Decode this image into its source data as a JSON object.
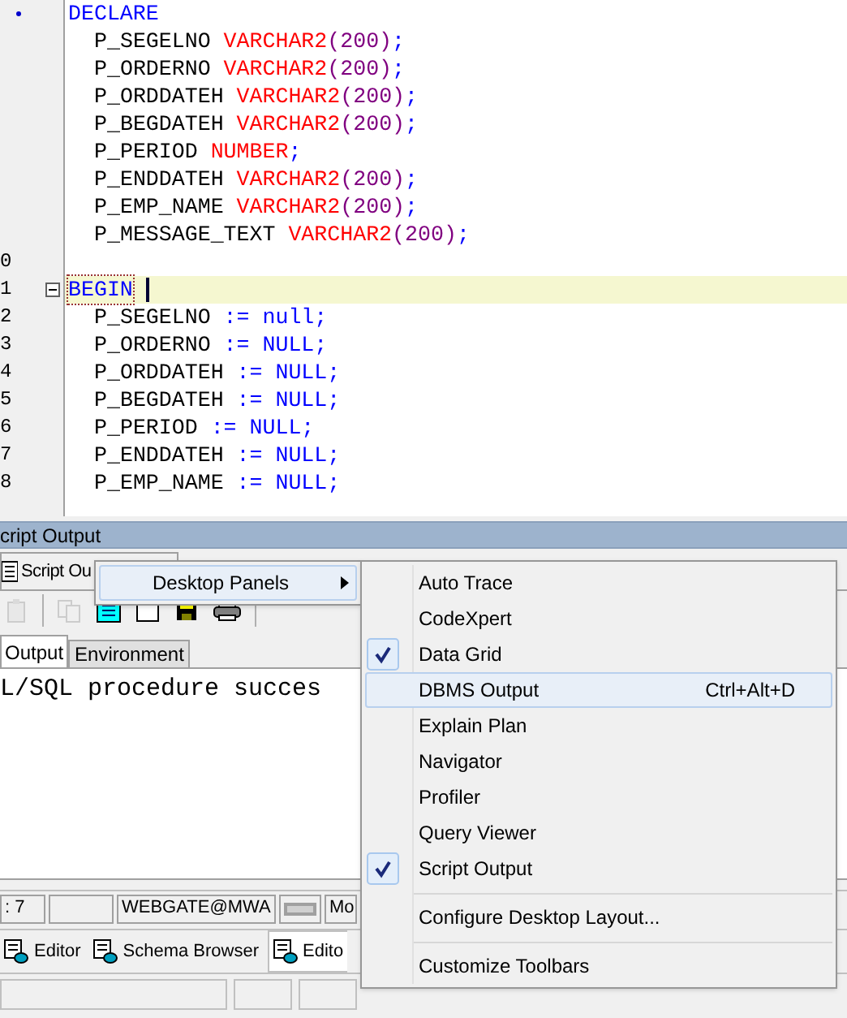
{
  "editor": {
    "lines": [
      {
        "bookmark": true,
        "tokens": [
          {
            "kind": "keyword",
            "text": "DECLARE"
          }
        ],
        "children": [
          {
            "tokens": [
              {
                "kind": "name",
                "text": "P_SEGELNO "
              },
              {
                "kind": "type",
                "text": "VARCHAR2"
              },
              {
                "kind": "size",
                "text": "(200)"
              },
              {
                "kind": "keyword",
                "text": ";"
              }
            ]
          },
          {
            "tokens": [
              {
                "kind": "name",
                "text": "P_ORDERNO "
              },
              {
                "kind": "type",
                "text": "VARCHAR2"
              },
              {
                "kind": "size",
                "text": "(200)"
              },
              {
                "kind": "keyword",
                "text": ";"
              }
            ]
          },
          {
            "tokens": [
              {
                "kind": "name",
                "text": "P_ORDDATEH "
              },
              {
                "kind": "type",
                "text": "VARCHAR2"
              },
              {
                "kind": "size",
                "text": "(200)"
              },
              {
                "kind": "keyword",
                "text": ";"
              }
            ]
          },
          {
            "tokens": [
              {
                "kind": "name",
                "text": "P_BEGDATEH "
              },
              {
                "kind": "type",
                "text": "VARCHAR2"
              },
              {
                "kind": "size",
                "text": "(200)"
              },
              {
                "kind": "keyword",
                "text": ";"
              }
            ]
          },
          {
            "tokens": [
              {
                "kind": "name",
                "text": "P_PERIOD "
              },
              {
                "kind": "type",
                "text": "NUMBER"
              },
              {
                "kind": "keyword",
                "text": ";"
              }
            ]
          },
          {
            "tokens": [
              {
                "kind": "name",
                "text": "P_ENDDATEH "
              },
              {
                "kind": "type",
                "text": "VARCHAR2"
              },
              {
                "kind": "size",
                "text": "(200)"
              },
              {
                "kind": "keyword",
                "text": ";"
              }
            ]
          },
          {
            "tokens": [
              {
                "kind": "name",
                "text": "P_EMP_NAME "
              },
              {
                "kind": "type",
                "text": "VARCHAR2"
              },
              {
                "kind": "size",
                "text": "(200)"
              },
              {
                "kind": "keyword",
                "text": ";"
              }
            ]
          },
          {
            "tokens": [
              {
                "kind": "name",
                "text": "P_MESSAGE_TEXT "
              },
              {
                "kind": "type",
                "text": "VARCHAR2"
              },
              {
                "kind": "size",
                "text": "(200)"
              },
              {
                "kind": "keyword",
                "text": ";"
              }
            ]
          }
        ]
      },
      {
        "number": "0"
      },
      {
        "number": "1",
        "collapsible": true,
        "current": true,
        "tokens": [
          {
            "kind": "keyword",
            "text": "BEGIN"
          }
        ],
        "children": [
          {
            "number": "2",
            "tokens": [
              {
                "kind": "name",
                "text": "P_SEGELNO "
              },
              {
                "kind": "keyword",
                "text": ":= null;"
              }
            ]
          },
          {
            "number": "3",
            "tokens": [
              {
                "kind": "name",
                "text": "P_ORDERNO "
              },
              {
                "kind": "keyword",
                "text": ":= NULL;"
              }
            ]
          },
          {
            "number": "4",
            "tokens": [
              {
                "kind": "name",
                "text": "P_ORDDATEH "
              },
              {
                "kind": "keyword",
                "text": ":= NULL;"
              }
            ]
          },
          {
            "number": "5",
            "tokens": [
              {
                "kind": "name",
                "text": "P_BEGDATEH "
              },
              {
                "kind": "keyword",
                "text": ":= NULL;"
              }
            ]
          },
          {
            "number": "6",
            "tokens": [
              {
                "kind": "name",
                "text": "P_PERIOD "
              },
              {
                "kind": "keyword",
                "text": ":= NULL;"
              }
            ]
          },
          {
            "number": "7",
            "tokens": [
              {
                "kind": "name",
                "text": "P_ENDDATEH "
              },
              {
                "kind": "keyword",
                "text": ":= NULL;"
              }
            ]
          },
          {
            "number": "8",
            "tokens": [
              {
                "kind": "name",
                "text": "P_EMP_NAME "
              },
              {
                "kind": "keyword",
                "text": ":= NULL;"
              }
            ]
          }
        ]
      }
    ]
  },
  "panel": {
    "title": "cript Output",
    "tab": "Script Ou",
    "toolbar": [
      {
        "kind": "paste",
        "disabled": true
      },
      {
        "kind": "sep"
      },
      {
        "kind": "copy",
        "disabled": true
      },
      {
        "kind": "doc",
        "disabled": false
      },
      {
        "kind": "blank",
        "disabled": false
      },
      {
        "kind": "save",
        "disabled": false
      },
      {
        "kind": "print",
        "disabled": false
      },
      {
        "kind": "sep"
      }
    ],
    "tabs": [
      {
        "label": "Output",
        "selected": true
      },
      {
        "label": "Environment",
        "selected": false
      }
    ],
    "output": "L/SQL procedure succes"
  },
  "status_bar": {
    "position": ": 7",
    "connection": "WEBGATE@MWA",
    "mode": "Mo"
  },
  "taskbar": [
    {
      "label": "Editor",
      "selected": false
    },
    {
      "label": "Schema Browser",
      "selected": false
    },
    {
      "label": "Edito",
      "selected": true
    }
  ],
  "menu": {
    "label": "Desktop Panels"
  },
  "submenu": [
    {
      "kind": "item",
      "label": "Auto Trace",
      "checked": false,
      "selected": false
    },
    {
      "kind": "item",
      "label": "CodeXpert",
      "checked": false,
      "selected": false
    },
    {
      "kind": "item",
      "label": "Data Grid",
      "checked": true,
      "selected": false
    },
    {
      "kind": "item",
      "label": "DBMS Output",
      "checked": false,
      "selected": true,
      "shortcut": "Ctrl+Alt+D"
    },
    {
      "kind": "item",
      "label": "Explain Plan",
      "checked": false,
      "selected": false
    },
    {
      "kind": "item",
      "label": "Navigator",
      "checked": false,
      "selected": false
    },
    {
      "kind": "item",
      "label": "Profiler",
      "checked": false,
      "selected": false
    },
    {
      "kind": "item",
      "label": "Query Viewer",
      "checked": false,
      "selected": false
    },
    {
      "kind": "item",
      "label": "Script Output",
      "checked": true,
      "selected": false
    },
    {
      "kind": "separator"
    },
    {
      "kind": "item",
      "label": "Configure Desktop Layout...",
      "checked": false,
      "selected": false
    },
    {
      "kind": "separator"
    },
    {
      "kind": "item",
      "label": "Customize Toolbars",
      "checked": false,
      "selected": false
    }
  ]
}
